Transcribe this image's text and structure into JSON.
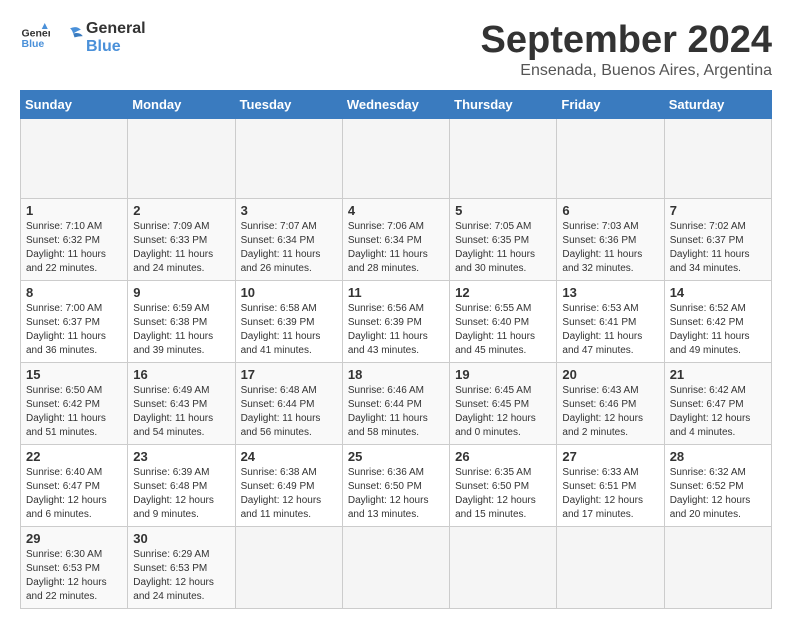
{
  "header": {
    "logo_general": "General",
    "logo_blue": "Blue",
    "month_title": "September 2024",
    "location": "Ensenada, Buenos Aires, Argentina"
  },
  "calendar": {
    "days_of_week": [
      "Sunday",
      "Monday",
      "Tuesday",
      "Wednesday",
      "Thursday",
      "Friday",
      "Saturday"
    ],
    "weeks": [
      [
        {
          "day": "",
          "empty": true
        },
        {
          "day": "",
          "empty": true
        },
        {
          "day": "",
          "empty": true
        },
        {
          "day": "",
          "empty": true
        },
        {
          "day": "",
          "empty": true
        },
        {
          "day": "",
          "empty": true
        },
        {
          "day": "",
          "empty": true
        }
      ],
      [
        {
          "day": "1",
          "info": "Sunrise: 7:10 AM\nSunset: 6:32 PM\nDaylight: 11 hours\nand 22 minutes."
        },
        {
          "day": "2",
          "info": "Sunrise: 7:09 AM\nSunset: 6:33 PM\nDaylight: 11 hours\nand 24 minutes."
        },
        {
          "day": "3",
          "info": "Sunrise: 7:07 AM\nSunset: 6:34 PM\nDaylight: 11 hours\nand 26 minutes."
        },
        {
          "day": "4",
          "info": "Sunrise: 7:06 AM\nSunset: 6:34 PM\nDaylight: 11 hours\nand 28 minutes."
        },
        {
          "day": "5",
          "info": "Sunrise: 7:05 AM\nSunset: 6:35 PM\nDaylight: 11 hours\nand 30 minutes."
        },
        {
          "day": "6",
          "info": "Sunrise: 7:03 AM\nSunset: 6:36 PM\nDaylight: 11 hours\nand 32 minutes."
        },
        {
          "day": "7",
          "info": "Sunrise: 7:02 AM\nSunset: 6:37 PM\nDaylight: 11 hours\nand 34 minutes."
        }
      ],
      [
        {
          "day": "8",
          "info": "Sunrise: 7:00 AM\nSunset: 6:37 PM\nDaylight: 11 hours\nand 36 minutes."
        },
        {
          "day": "9",
          "info": "Sunrise: 6:59 AM\nSunset: 6:38 PM\nDaylight: 11 hours\nand 39 minutes."
        },
        {
          "day": "10",
          "info": "Sunrise: 6:58 AM\nSunset: 6:39 PM\nDaylight: 11 hours\nand 41 minutes."
        },
        {
          "day": "11",
          "info": "Sunrise: 6:56 AM\nSunset: 6:39 PM\nDaylight: 11 hours\nand 43 minutes."
        },
        {
          "day": "12",
          "info": "Sunrise: 6:55 AM\nSunset: 6:40 PM\nDaylight: 11 hours\nand 45 minutes."
        },
        {
          "day": "13",
          "info": "Sunrise: 6:53 AM\nSunset: 6:41 PM\nDaylight: 11 hours\nand 47 minutes."
        },
        {
          "day": "14",
          "info": "Sunrise: 6:52 AM\nSunset: 6:42 PM\nDaylight: 11 hours\nand 49 minutes."
        }
      ],
      [
        {
          "day": "15",
          "info": "Sunrise: 6:50 AM\nSunset: 6:42 PM\nDaylight: 11 hours\nand 51 minutes."
        },
        {
          "day": "16",
          "info": "Sunrise: 6:49 AM\nSunset: 6:43 PM\nDaylight: 11 hours\nand 54 minutes."
        },
        {
          "day": "17",
          "info": "Sunrise: 6:48 AM\nSunset: 6:44 PM\nDaylight: 11 hours\nand 56 minutes."
        },
        {
          "day": "18",
          "info": "Sunrise: 6:46 AM\nSunset: 6:44 PM\nDaylight: 11 hours\nand 58 minutes."
        },
        {
          "day": "19",
          "info": "Sunrise: 6:45 AM\nSunset: 6:45 PM\nDaylight: 12 hours\nand 0 minutes."
        },
        {
          "day": "20",
          "info": "Sunrise: 6:43 AM\nSunset: 6:46 PM\nDaylight: 12 hours\nand 2 minutes."
        },
        {
          "day": "21",
          "info": "Sunrise: 6:42 AM\nSunset: 6:47 PM\nDaylight: 12 hours\nand 4 minutes."
        }
      ],
      [
        {
          "day": "22",
          "info": "Sunrise: 6:40 AM\nSunset: 6:47 PM\nDaylight: 12 hours\nand 6 minutes."
        },
        {
          "day": "23",
          "info": "Sunrise: 6:39 AM\nSunset: 6:48 PM\nDaylight: 12 hours\nand 9 minutes."
        },
        {
          "day": "24",
          "info": "Sunrise: 6:38 AM\nSunset: 6:49 PM\nDaylight: 12 hours\nand 11 minutes."
        },
        {
          "day": "25",
          "info": "Sunrise: 6:36 AM\nSunset: 6:50 PM\nDaylight: 12 hours\nand 13 minutes."
        },
        {
          "day": "26",
          "info": "Sunrise: 6:35 AM\nSunset: 6:50 PM\nDaylight: 12 hours\nand 15 minutes."
        },
        {
          "day": "27",
          "info": "Sunrise: 6:33 AM\nSunset: 6:51 PM\nDaylight: 12 hours\nand 17 minutes."
        },
        {
          "day": "28",
          "info": "Sunrise: 6:32 AM\nSunset: 6:52 PM\nDaylight: 12 hours\nand 20 minutes."
        }
      ],
      [
        {
          "day": "29",
          "info": "Sunrise: 6:30 AM\nSunset: 6:53 PM\nDaylight: 12 hours\nand 22 minutes."
        },
        {
          "day": "30",
          "info": "Sunrise: 6:29 AM\nSunset: 6:53 PM\nDaylight: 12 hours\nand 24 minutes."
        },
        {
          "day": "",
          "empty": true
        },
        {
          "day": "",
          "empty": true
        },
        {
          "day": "",
          "empty": true
        },
        {
          "day": "",
          "empty": true
        },
        {
          "day": "",
          "empty": true
        }
      ]
    ]
  }
}
